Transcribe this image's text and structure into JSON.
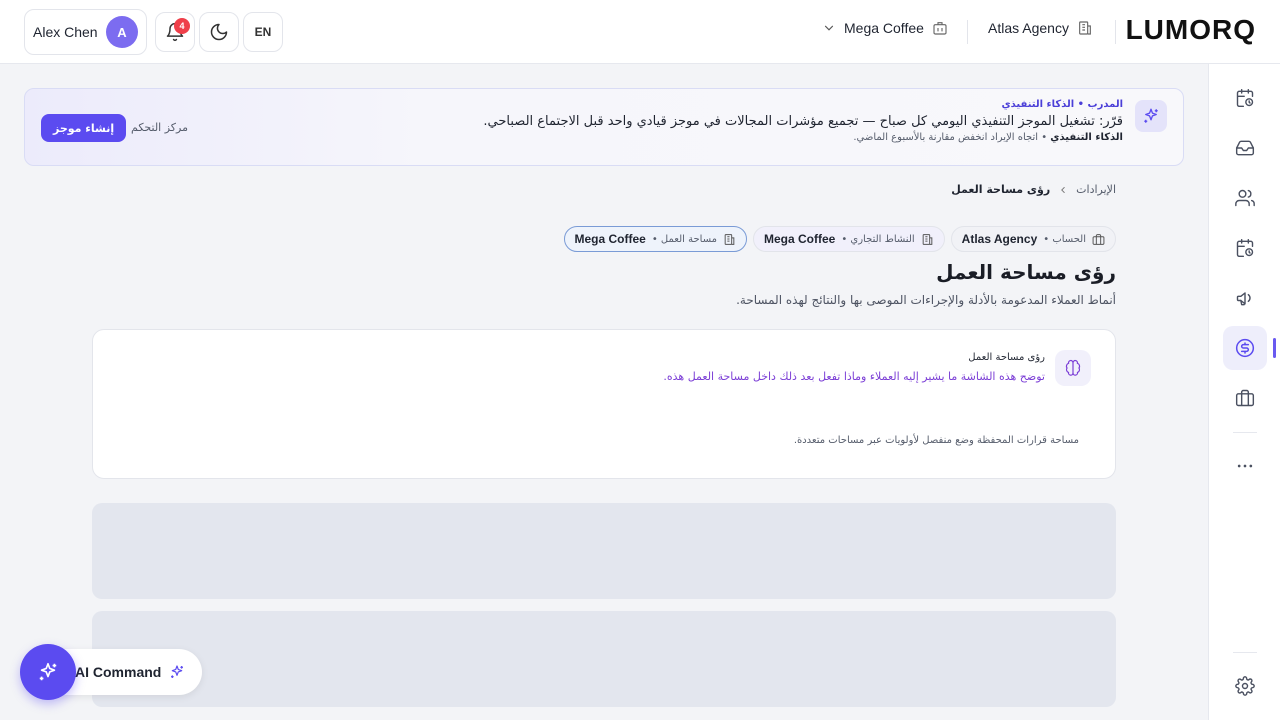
{
  "header": {
    "user_name": "Alex Chen",
    "avatar_initial": "A",
    "notification_count": "4",
    "language": "EN",
    "business": "Mega Coffee",
    "agency": "Atlas Agency",
    "logo": "LUMORQ"
  },
  "banner": {
    "kicker": "المدرب • الذكاء التنفيذي",
    "message": "قرّر: تشغيل الموجز التنفيذي اليومي كل صباح — تجميع مؤشرات المجالات في موجز قيادي واحد قبل الاجتماع الصباحي.",
    "sub_label": "الذكاء التنفيذي",
    "sub_text": " • اتجاه الإيراد انخفض مقارنة بالأسبوع الماضي.",
    "cta_label": "إنشاء موجز",
    "link_label": "مركز التحكم"
  },
  "breadcrumb": {
    "parent": "الإيرادات",
    "current": "رؤى مساحة العمل"
  },
  "context_chips": [
    {
      "label": "الحساب •",
      "value": "Atlas Agency"
    },
    {
      "label": "النشاط التجاري •",
      "value": "Mega Coffee"
    },
    {
      "label": "مساحة العمل •",
      "value": "Mega Coffee"
    }
  ],
  "page": {
    "title": "رؤى مساحة العمل",
    "subtitle": "أنماط العملاء المدعومة بالأدلة والإجراءات الموصى بها والنتائج لهذه المساحة."
  },
  "insight_card": {
    "title": "رؤى مساحة العمل",
    "description": "توضح هذه الشاشة ما يشير إليه العملاء وماذا تفعل بعد ذلك داخل مساحة العمل هذه.",
    "footer": "مساحة قرارات المحفظة وضع منفصل لأولويات عبر مساحات متعددة."
  },
  "ai_command": {
    "label": "AI Command"
  },
  "icons": {
    "sidebar": [
      "calendar-clock-icon",
      "inbox-icon",
      "users-icon",
      "calendar-clock-icon",
      "megaphone-icon",
      "dollar-icon",
      "briefcase-icon",
      "more-icon",
      "settings-icon"
    ]
  },
  "colors": {
    "accent": "#5b4bf0",
    "badge": "#ef3f4a",
    "insight_text": "#7c3fd6"
  }
}
